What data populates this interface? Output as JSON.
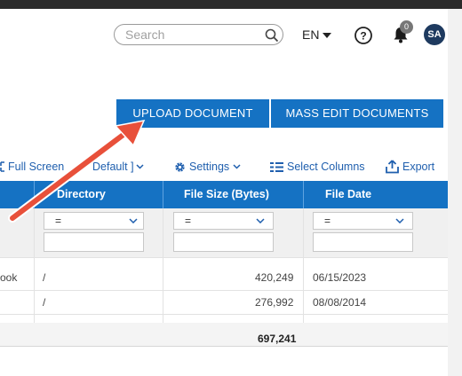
{
  "header": {
    "search_placeholder": "Search",
    "language": "EN",
    "notifications_count": "0",
    "avatar_initials": "SA"
  },
  "actions": {
    "upload_label": "UPLOAD DOCUMENT",
    "mass_edit_label": "MASS EDIT DOCUMENTS"
  },
  "toolbar": {
    "full_screen": "Full Screen",
    "view_partial": "Default ]",
    "settings": "Settings",
    "select_columns": "Select Columns",
    "export": "Export"
  },
  "grid": {
    "columns": [
      "Directory",
      "File Size (Bytes)",
      "File Date"
    ],
    "filter_operator": "=",
    "rows": [
      {
        "name_partial": "ook",
        "directory": "/",
        "size": "420,249",
        "date": "06/15/2023"
      },
      {
        "name_partial": "",
        "directory": "/",
        "size": "276,992",
        "date": "08/08/2014"
      }
    ],
    "total_size": "697,241"
  },
  "colors": {
    "accent": "#1572c3",
    "annotation_arrow": "#e8503a"
  }
}
